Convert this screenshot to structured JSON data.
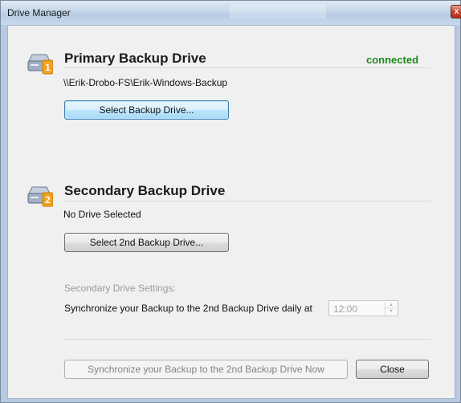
{
  "window": {
    "title": "Drive Manager",
    "close_glyph": "x"
  },
  "primary": {
    "heading": "Primary Backup Drive",
    "status": "connected",
    "path": "\\\\Erik-Drobo-FS\\Erik-Windows-Backup",
    "button_label": "Select Backup Drive...",
    "icon_number": "1"
  },
  "secondary": {
    "heading": "Secondary Backup Drive",
    "drive_text": "No Drive Selected",
    "button_label": "Select 2nd Backup Drive...",
    "icon_number": "2",
    "settings_label": "Secondary Drive Settings:",
    "sync_label": "Synchronize your Backup to the 2nd Backup Drive daily at",
    "time_value": "12:00",
    "spin_up": "▲",
    "spin_down": "▼"
  },
  "footer": {
    "sync_now_label": "Synchronize your Backup to the 2nd Backup Drive Now",
    "close_label": "Close"
  },
  "colors": {
    "status_green": "#1c8a1c",
    "badge_orange": "#f2a01e",
    "focus_blue": "#3c7fb1"
  }
}
